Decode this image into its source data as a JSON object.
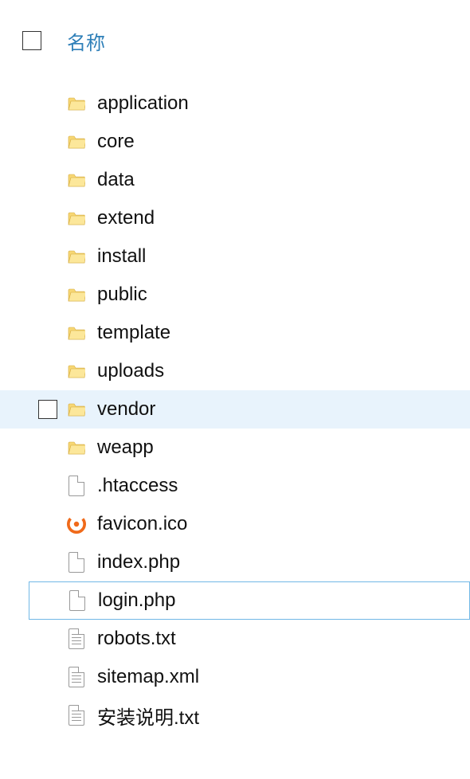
{
  "header": {
    "name_column": "名称"
  },
  "files": [
    {
      "name": "application",
      "type": "folder",
      "state": "normal"
    },
    {
      "name": "core",
      "type": "folder",
      "state": "normal"
    },
    {
      "name": "data",
      "type": "folder",
      "state": "normal"
    },
    {
      "name": "extend",
      "type": "folder",
      "state": "normal"
    },
    {
      "name": "install",
      "type": "folder",
      "state": "normal"
    },
    {
      "name": "public",
      "type": "folder",
      "state": "normal"
    },
    {
      "name": "template",
      "type": "folder",
      "state": "normal"
    },
    {
      "name": "uploads",
      "type": "folder",
      "state": "normal"
    },
    {
      "name": "vendor",
      "type": "folder",
      "state": "hovered"
    },
    {
      "name": "weapp",
      "type": "folder",
      "state": "normal"
    },
    {
      "name": ".htaccess",
      "type": "blank",
      "state": "normal"
    },
    {
      "name": "favicon.ico",
      "type": "favicon",
      "state": "normal"
    },
    {
      "name": "index.php",
      "type": "blank",
      "state": "normal"
    },
    {
      "name": "login.php",
      "type": "blank",
      "state": "selected"
    },
    {
      "name": "robots.txt",
      "type": "text",
      "state": "normal"
    },
    {
      "name": "sitemap.xml",
      "type": "text",
      "state": "normal"
    },
    {
      "name": "安装说明.txt",
      "type": "text",
      "state": "normal"
    }
  ]
}
